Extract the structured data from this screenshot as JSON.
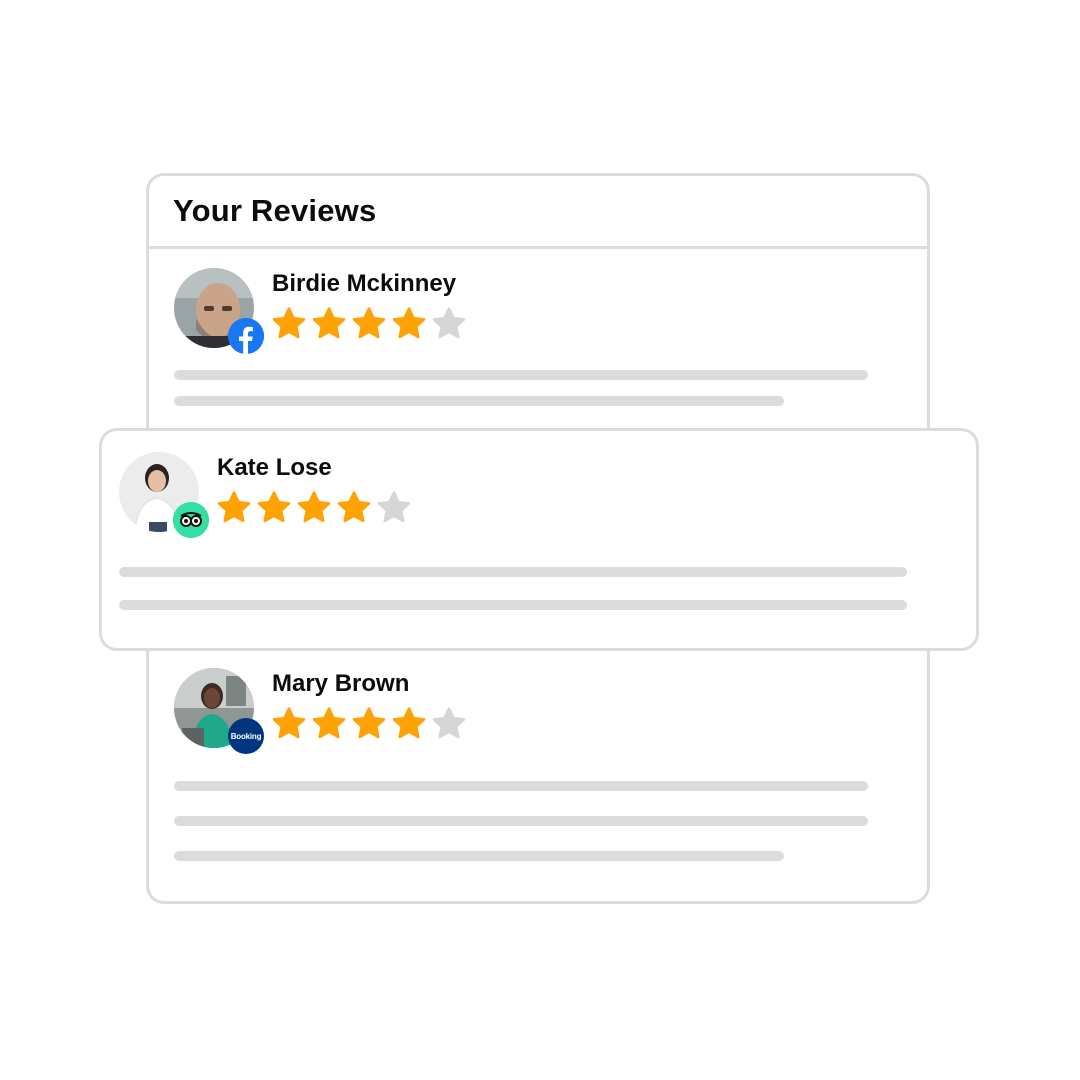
{
  "title": "Your Reviews",
  "colors": {
    "star_filled": "#FFA305",
    "star_empty": "#D6D6D6",
    "border": "#DCDCDC",
    "line": "#DCDCDC"
  },
  "reviews": [
    {
      "name": "Birdie Mckinney",
      "rating": 4,
      "max_rating": 5,
      "source": "facebook",
      "source_icon": "facebook-icon"
    },
    {
      "name": "Kate Lose",
      "rating": 4,
      "max_rating": 5,
      "source": "tripadvisor",
      "source_icon": "tripadvisor-icon"
    },
    {
      "name": "Mary Brown",
      "rating": 4,
      "max_rating": 5,
      "source": "booking",
      "source_icon": "booking-icon",
      "badge_text": "Booking"
    }
  ]
}
